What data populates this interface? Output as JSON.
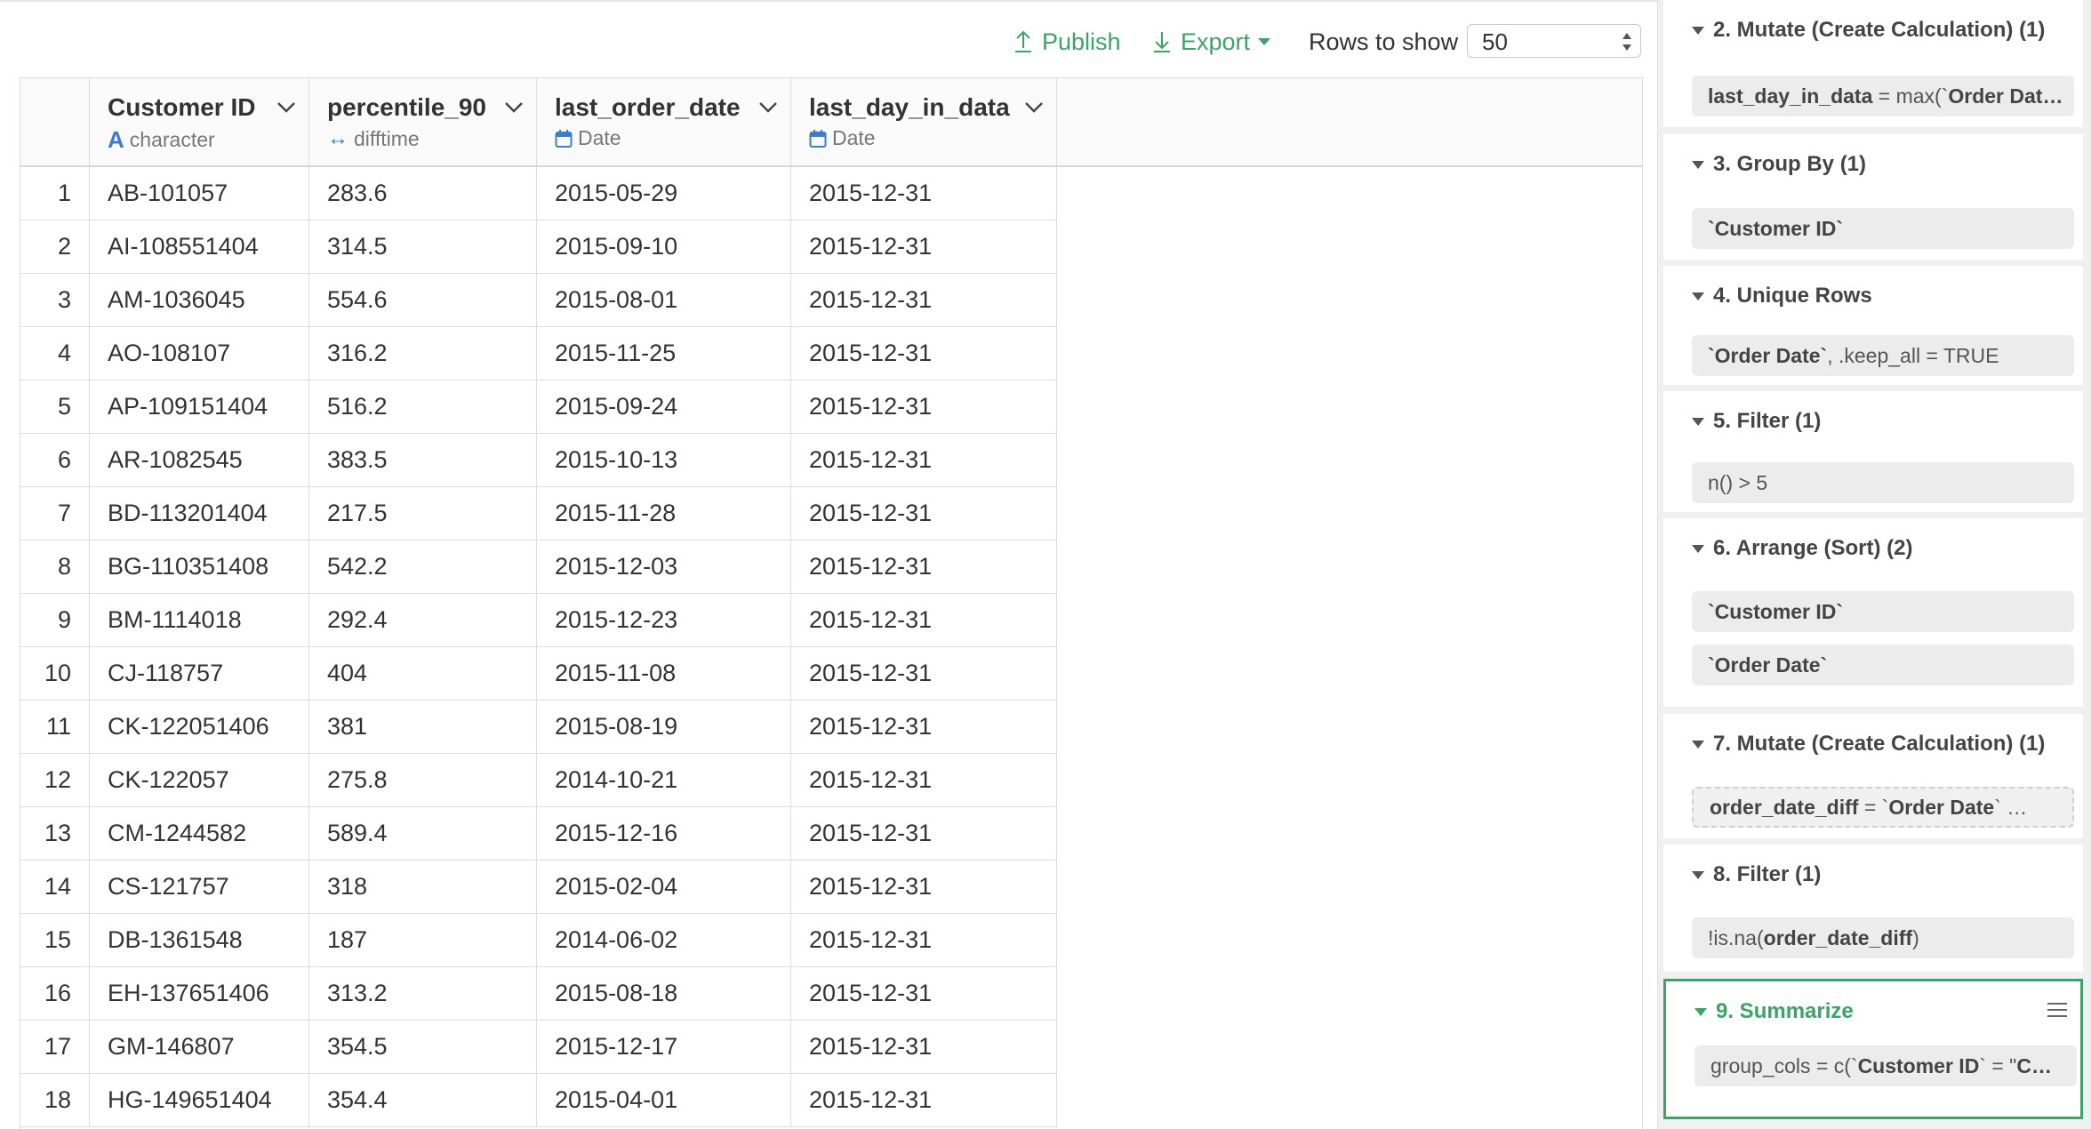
{
  "toolbar": {
    "publish_label": "Publish",
    "export_label": "Export",
    "rows_label": "Rows to show",
    "rows_value": "50"
  },
  "colors": {
    "accent": "#3aa564",
    "type_icon": "#3a7bd5"
  },
  "table": {
    "columns": [
      {
        "name": "Customer ID",
        "type": "character",
        "type_icon": "character-icon"
      },
      {
        "name": "percentile_90",
        "type": "difftime",
        "type_icon": "difftime-icon"
      },
      {
        "name": "last_order_date",
        "type": "Date",
        "type_icon": "calendar-icon"
      },
      {
        "name": "last_day_in_data",
        "type": "Date",
        "type_icon": "calendar-icon"
      }
    ],
    "rows": [
      [
        "1",
        "AB-101057",
        "283.6",
        "2015-05-29",
        "2015-12-31"
      ],
      [
        "2",
        "AI-108551404",
        "314.5",
        "2015-09-10",
        "2015-12-31"
      ],
      [
        "3",
        "AM-1036045",
        "554.6",
        "2015-08-01",
        "2015-12-31"
      ],
      [
        "4",
        "AO-108107",
        "316.2",
        "2015-11-25",
        "2015-12-31"
      ],
      [
        "5",
        "AP-109151404",
        "516.2",
        "2015-09-24",
        "2015-12-31"
      ],
      [
        "6",
        "AR-1082545",
        "383.5",
        "2015-10-13",
        "2015-12-31"
      ],
      [
        "7",
        "BD-113201404",
        "217.5",
        "2015-11-28",
        "2015-12-31"
      ],
      [
        "8",
        "BG-110351408",
        "542.2",
        "2015-12-03",
        "2015-12-31"
      ],
      [
        "9",
        "BM-1114018",
        "292.4",
        "2015-12-23",
        "2015-12-31"
      ],
      [
        "10",
        "CJ-118757",
        "404",
        "2015-11-08",
        "2015-12-31"
      ],
      [
        "11",
        "CK-122051406",
        "381",
        "2015-08-19",
        "2015-12-31"
      ],
      [
        "12",
        "CK-122057",
        "275.8",
        "2014-10-21",
        "2015-12-31"
      ],
      [
        "13",
        "CM-1244582",
        "589.4",
        "2015-12-16",
        "2015-12-31"
      ],
      [
        "14",
        "CS-121757",
        "318",
        "2015-02-04",
        "2015-12-31"
      ],
      [
        "15",
        "DB-1361548",
        "187",
        "2014-06-02",
        "2015-12-31"
      ],
      [
        "16",
        "EH-137651406",
        "313.2",
        "2015-08-18",
        "2015-12-31"
      ],
      [
        "17",
        "GM-146807",
        "354.5",
        "2015-12-17",
        "2015-12-31"
      ],
      [
        "18",
        "HG-149651404",
        "354.4",
        "2015-04-01",
        "2015-12-31"
      ]
    ]
  },
  "steps": [
    {
      "title": "2. Mutate (Create Calculation) (1)",
      "items": [
        {
          "parts": [
            [
              "b",
              "last_day_in_data"
            ],
            [
              "t",
              " = max(`"
            ],
            [
              "b",
              "Order Dat…"
            ]
          ]
        }
      ]
    },
    {
      "title": "3. Group By (1)",
      "items": [
        {
          "parts": [
            [
              "b",
              "`Customer ID`"
            ]
          ]
        }
      ]
    },
    {
      "title": "4. Unique Rows",
      "items": [
        {
          "parts": [
            [
              "b",
              "`Order Date`"
            ],
            [
              "t",
              ", .keep_all = TRUE"
            ]
          ]
        }
      ]
    },
    {
      "title": "5. Filter (1)",
      "items": [
        {
          "parts": [
            [
              "t",
              "n() > 5"
            ]
          ]
        }
      ]
    },
    {
      "title": "6. Arrange (Sort) (2)",
      "items": [
        {
          "parts": [
            [
              "b",
              "`Customer ID`"
            ]
          ]
        },
        {
          "parts": [
            [
              "b",
              "`Order Date`"
            ]
          ]
        }
      ]
    },
    {
      "title": "7. Mutate (Create Calculation) (1)",
      "items": [
        {
          "dashed": true,
          "parts": [
            [
              "b",
              "order_date_diff"
            ],
            [
              "t",
              " = `"
            ],
            [
              "b",
              "Order Date"
            ],
            [
              "t",
              "` …"
            ]
          ]
        }
      ]
    },
    {
      "title": "8. Filter (1)",
      "items": [
        {
          "parts": [
            [
              "t",
              "!is.na("
            ],
            [
              "b",
              "order_date_diff"
            ],
            [
              "t",
              ")"
            ]
          ]
        }
      ]
    },
    {
      "title": "9. Summarize",
      "active": true,
      "items": [
        {
          "parts": [
            [
              "t",
              "group_cols = c(`"
            ],
            [
              "b",
              "Customer ID"
            ],
            [
              "t",
              "` = \""
            ],
            [
              "b",
              "C…"
            ]
          ]
        }
      ]
    }
  ]
}
